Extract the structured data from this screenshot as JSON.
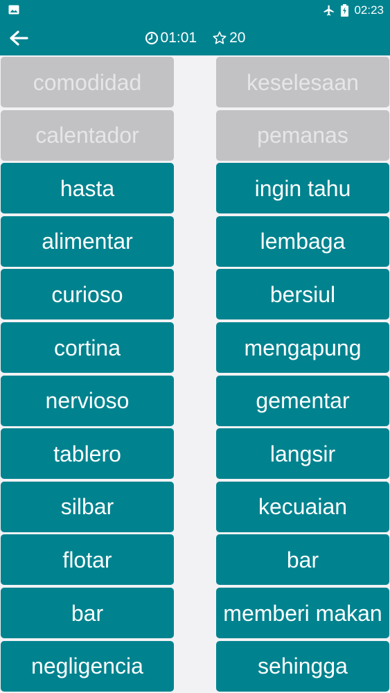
{
  "statusbar": {
    "time": "02:23",
    "icons": [
      "image-icon",
      "airplane-icon",
      "battery-charging-icon"
    ]
  },
  "toolbar": {
    "timer": "01:01",
    "stars": "20",
    "icons": [
      "back-arrow-icon",
      "clock-icon",
      "star-outline-icon"
    ]
  },
  "colors": {
    "primary": "#00838f",
    "matched_tile": "#c2c2c4",
    "matched_text": "#e6e6e8",
    "background": "#f2f2f4"
  },
  "left_words": [
    {
      "text": "comodidad",
      "matched": true
    },
    {
      "text": "calentador",
      "matched": true
    },
    {
      "text": "hasta",
      "matched": false
    },
    {
      "text": "alimentar",
      "matched": false
    },
    {
      "text": "curioso",
      "matched": false
    },
    {
      "text": "cortina",
      "matched": false
    },
    {
      "text": "nervioso",
      "matched": false
    },
    {
      "text": "tablero",
      "matched": false
    },
    {
      "text": "silbar",
      "matched": false
    },
    {
      "text": "flotar",
      "matched": false
    },
    {
      "text": "bar",
      "matched": false
    },
    {
      "text": "negligencia",
      "matched": false
    }
  ],
  "right_words": [
    {
      "text": "keselesaan",
      "matched": true
    },
    {
      "text": "pemanas",
      "matched": true
    },
    {
      "text": "ingin tahu",
      "matched": false
    },
    {
      "text": "lembaga",
      "matched": false
    },
    {
      "text": "bersiul",
      "matched": false
    },
    {
      "text": "mengapung",
      "matched": false
    },
    {
      "text": "gementar",
      "matched": false
    },
    {
      "text": "langsir",
      "matched": false
    },
    {
      "text": "kecuaian",
      "matched": false
    },
    {
      "text": "bar",
      "matched": false
    },
    {
      "text": "memberi makan",
      "matched": false
    },
    {
      "text": "sehingga",
      "matched": false
    }
  ]
}
